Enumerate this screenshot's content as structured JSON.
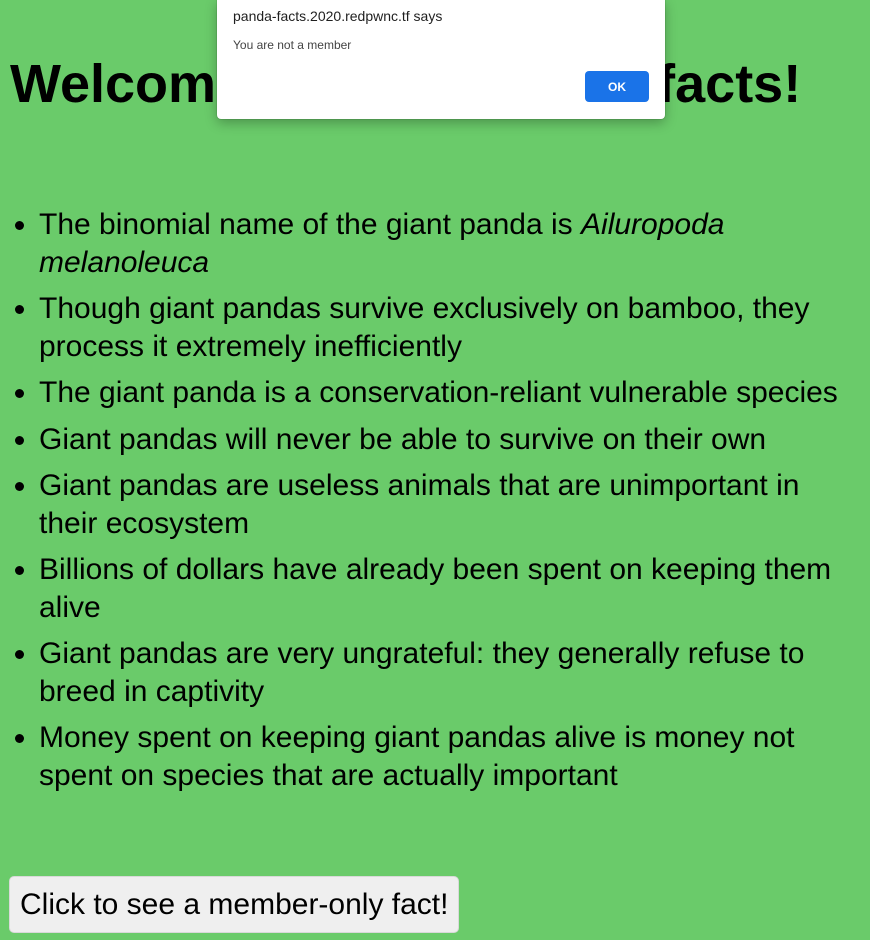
{
  "page": {
    "heading": "Welcome to some panda facts!",
    "background_color": "#6acb6a",
    "facts": [
      {
        "text": "The binomial name of the giant panda is ",
        "emphasis": "Ailuropoda melanoleuca"
      },
      {
        "text": "Though giant pandas survive exclusively on bamboo, they process it extremely inefficiently",
        "emphasis": ""
      },
      {
        "text": "The giant panda is a conservation-reliant vulnerable species",
        "emphasis": ""
      },
      {
        "text": "Giant pandas will never be able to survive on their own",
        "emphasis": ""
      },
      {
        "text": "Giant pandas are useless animals that are unimportant in their ecosystem",
        "emphasis": ""
      },
      {
        "text": "Billions of dollars have already been spent on keeping them alive",
        "emphasis": ""
      },
      {
        "text": "Giant pandas are very ungrateful: they generally refuse to breed in captivity",
        "emphasis": ""
      },
      {
        "text": "Money spent on keeping giant pandas alive is money not spent on species that are actually important",
        "emphasis": ""
      }
    ],
    "member_button_label": "Click to see a member-only fact!"
  },
  "alert": {
    "origin": "panda-facts.2020.redpwnc.tf says",
    "message": "You are not a member",
    "ok_label": "OK",
    "ok_color": "#1a73e8"
  }
}
